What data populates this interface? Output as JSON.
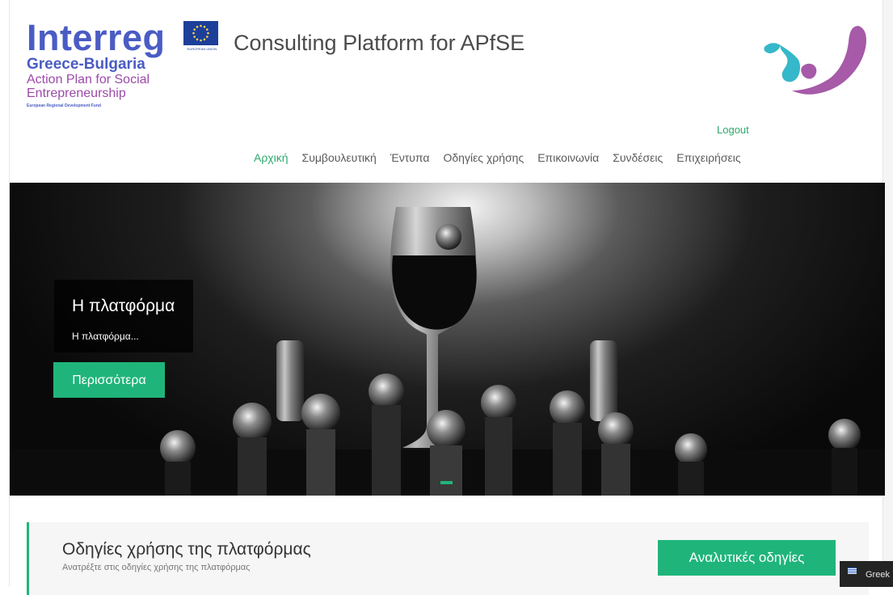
{
  "header": {
    "logo": {
      "wordmark": "Interreg",
      "program": "Greece-Bulgaria",
      "project_line1": "Action Plan for Social",
      "project_line2": "Entrepreneurship",
      "fund": "European Regional Development Fund",
      "eu_label": "EUROPEAN UNION"
    },
    "site_title": "Consulting Platform for APfSE",
    "logout": "Logout",
    "nav": [
      {
        "label": "Αρχική",
        "active": true
      },
      {
        "label": "Συμβουλευτική",
        "active": false
      },
      {
        "label": "Έντυπα",
        "active": false
      },
      {
        "label": "Οδηγίες χρήσης",
        "active": false
      },
      {
        "label": "Επικοινωνία",
        "active": false
      },
      {
        "label": "Συνδέσεις",
        "active": false
      },
      {
        "label": "Επιχειρήσεις",
        "active": false
      }
    ]
  },
  "hero": {
    "title": "Η πλατφόρμα",
    "text": "Η πλατφόρμα...",
    "button": "Περισσότερα"
  },
  "guide": {
    "title": "Οδηγίες χρήσης της πλατφόρμας",
    "subtitle": "Ανατρέξτε στις οδηγίες χρήσης της πλατφόρμας",
    "button": "Αναλυτικές οδηγίες"
  },
  "language": {
    "label": "Greek",
    "icon": "greek-flag-icon"
  },
  "colors": {
    "accent": "#1fb57a",
    "brand_blue": "#4a5cc4",
    "brand_purple": "#9b4aa8"
  }
}
